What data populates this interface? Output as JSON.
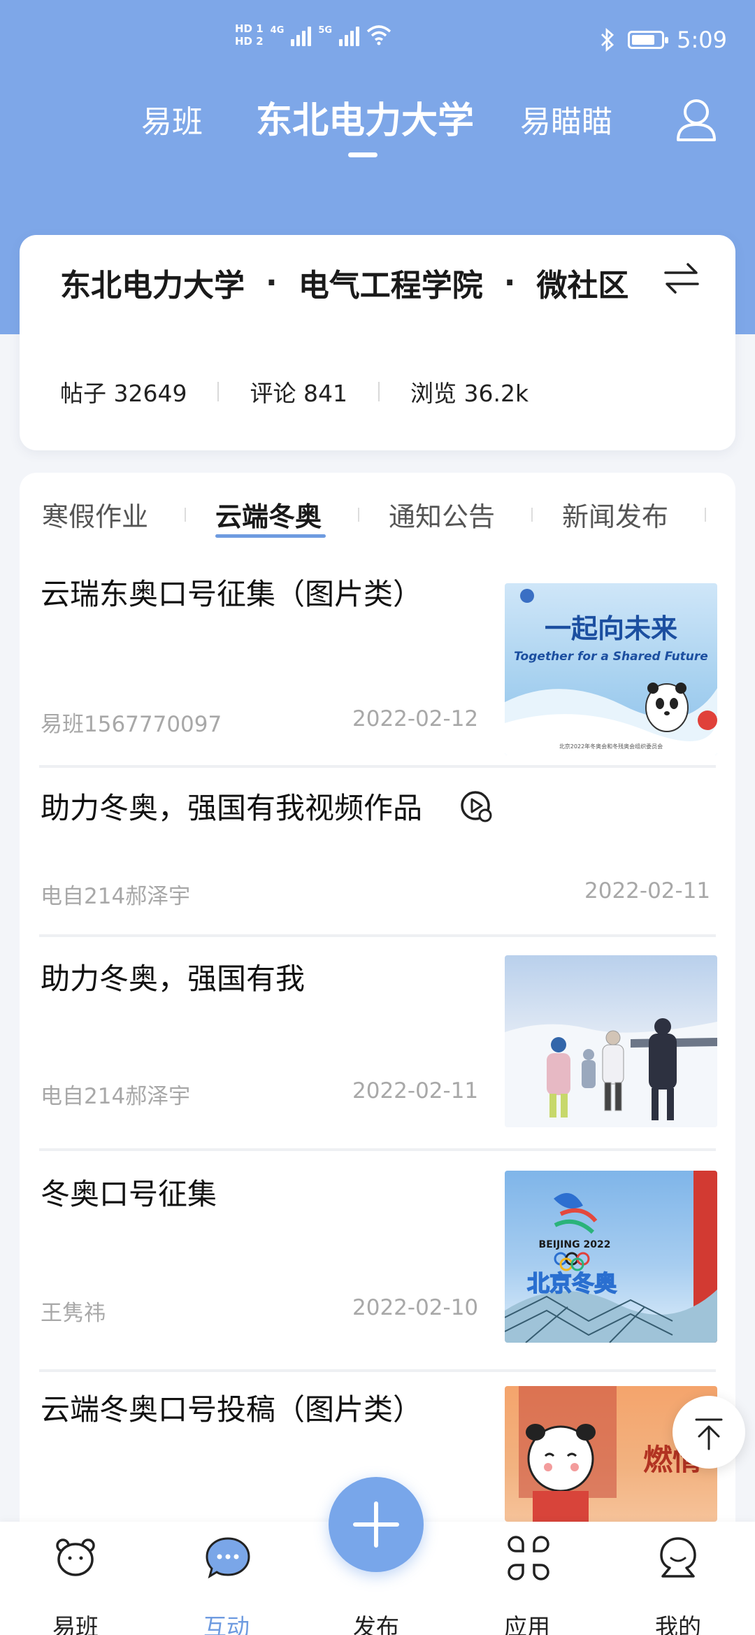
{
  "status_bar": {
    "time": "5:09",
    "hd1": "HD 1",
    "hd2": "HD 2",
    "net1": "4G",
    "net2": "5G"
  },
  "top_nav": {
    "tabs": [
      "易班",
      "东北电力大学",
      "易瞄瞄"
    ],
    "active_index": 1
  },
  "community": {
    "school": "东北电力大学",
    "college": "电气工程学院",
    "section": "微社区",
    "separator": "·",
    "stats": {
      "posts_label": "帖子",
      "posts": "32649",
      "comments_label": "评论",
      "comments": "841",
      "views_label": "浏览",
      "views": "36.2k"
    }
  },
  "category_tabs": [
    "寒假作业",
    "云端冬奥",
    "通知公告",
    "新闻发布"
  ],
  "active_category": 1,
  "posts": [
    {
      "title": "云瑞东奥口号征集（图片类）",
      "author": "易班1567770097",
      "date": "2022-02-12",
      "image_text_cn": "一起向未来",
      "image_text_en": "Together for a Shared Future",
      "image_caption": "北京2022年冬奥会和冬残奥会组织委员会"
    },
    {
      "title": "助力冬奥，强国有我视频作品",
      "author": "电自214郝泽宇",
      "date": "2022-02-11"
    },
    {
      "title": "助力冬奥，强国有我",
      "author": "电自214郝泽宇",
      "date": "2022-02-11"
    },
    {
      "title": "冬奥口号征集",
      "author": "王隽祎",
      "date": "2022-02-10",
      "image_text_cn": "北京冬奥",
      "image_text_en": "BEIJING 2022"
    },
    {
      "title": "云端冬奥口号投稿（图片类）",
      "image_text_cn": "燃情"
    }
  ],
  "bottom_nav": {
    "items": [
      "易班",
      "互动",
      "发布",
      "应用",
      "我的"
    ],
    "active_index": 1
  },
  "colors": {
    "accent": "#78a6ea",
    "header_bg": "#7ea7e8",
    "muted_text": "#a8a8a8"
  }
}
